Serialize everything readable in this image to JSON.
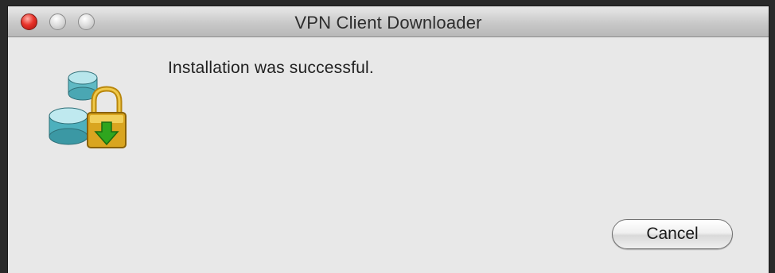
{
  "window": {
    "title": "VPN Client Downloader"
  },
  "dialog": {
    "message": "Installation was successful.",
    "icon": "vpn-installer-lock-icon"
  },
  "buttons": {
    "cancel_label": "Cancel"
  },
  "colors": {
    "close_button": "#e8332a",
    "window_background": "#e8e8e8",
    "lock_gold": "#d9a520",
    "database_teal": "#5fb9c4",
    "arrow_green": "#2fa51e"
  }
}
